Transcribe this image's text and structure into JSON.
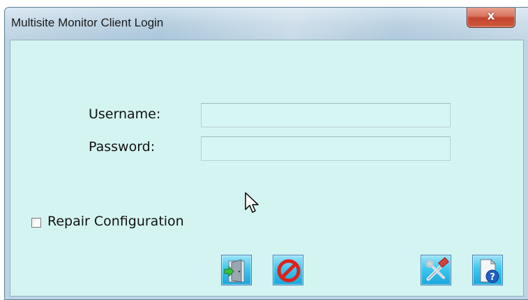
{
  "window": {
    "title": "Multisite Monitor Client Login",
    "close_glyph": "x"
  },
  "form": {
    "username_label": "Username:",
    "username_value": "",
    "password_label": "Password:",
    "password_value": "",
    "repair_label": "Repair Configuration",
    "repair_checked": false
  },
  "buttons": {
    "login_icon": "door-enter-icon",
    "cancel_icon": "prohibited-icon",
    "settings_icon": "tools-icon",
    "help_icon": "help-document-icon"
  },
  "colors": {
    "client_background": "#d4f4f1",
    "button_fill": "#1aa6dc",
    "close_button": "#c4452d",
    "cancel_red": "#e0201a"
  }
}
